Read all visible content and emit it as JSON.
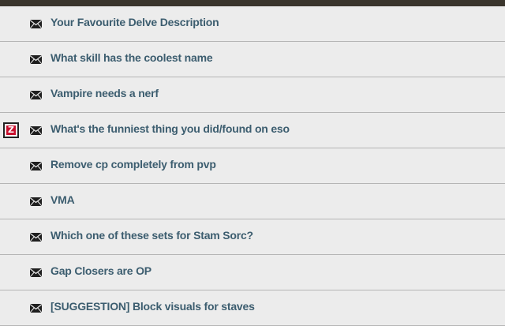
{
  "threads": [
    {
      "title": "Your Favourite Delve Description",
      "icon": "mail-icon",
      "badge": null
    },
    {
      "title": "What skill has the coolest name",
      "icon": "mail-icon",
      "badge": null
    },
    {
      "title": "Vampire needs a nerf",
      "icon": "mail-icon",
      "badge": null
    },
    {
      "title": "What's the funniest thing you did/found on eso",
      "icon": "mail-icon",
      "badge": "Z"
    },
    {
      "title": "Remove cp completely from pvp",
      "icon": "mail-icon",
      "badge": null
    },
    {
      "title": "VMA",
      "icon": "mail-icon",
      "badge": null
    },
    {
      "title": "Which one of these sets for Stam Sorc?",
      "icon": "mail-icon",
      "badge": null
    },
    {
      "title": "Gap Closers are OP",
      "icon": "mail-icon",
      "badge": null
    },
    {
      "title": "[SUGGESTION] Block visuals for staves",
      "icon": "mail-icon",
      "badge": null
    }
  ],
  "colors": {
    "background": "#ececec",
    "title_text": "#3c5d6f",
    "divider": "#b5b5b5",
    "top_border": "#3a352c",
    "badge_red": "#c8102e"
  }
}
